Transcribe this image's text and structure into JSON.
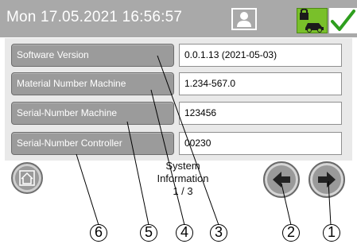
{
  "status_bar": {
    "datetime": "Mon 17.05.2021  16:56:57",
    "user_icon": "user-icon",
    "lock_icon": "lock-car-icon",
    "confirm_icon": "checkmark-icon"
  },
  "info_rows": [
    {
      "label": "Software Version",
      "value": "0.0.1.13  (2021-05-03)"
    },
    {
      "label": "Material Number Machine",
      "value": "1.234-567.0"
    },
    {
      "label": "Serial-Number Machine",
      "value": "123456"
    },
    {
      "label": "Serial-Number Controller",
      "value": "00230"
    }
  ],
  "footer": {
    "title_line1": "System",
    "title_line2": "Information",
    "page": "1 / 3",
    "home_icon": "home-icon",
    "prev_icon": "arrow-left-icon",
    "next_icon": "arrow-right-icon"
  },
  "callouts": [
    "1",
    "2",
    "3",
    "4",
    "5",
    "6"
  ],
  "colors": {
    "topbar": "#a9a9a9",
    "label_bg": "#9b9b9b",
    "accent_green": "#79c02a",
    "check_green": "#2e9e1e"
  }
}
